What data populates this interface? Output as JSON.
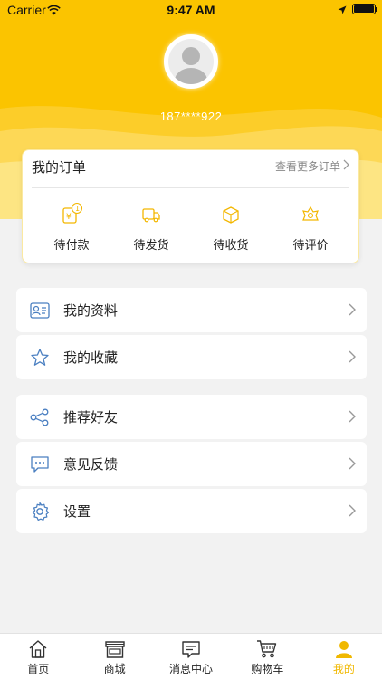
{
  "status_bar": {
    "carrier": "Carrier",
    "time": "9:47 AM"
  },
  "profile": {
    "phone": "187****922"
  },
  "orders": {
    "title": "我的订单",
    "more_label": "查看更多订单",
    "badge_count": "1",
    "items": [
      {
        "label": "待付款",
        "icon": "payment-icon"
      },
      {
        "label": "待发货",
        "icon": "truck-icon"
      },
      {
        "label": "待收货",
        "icon": "package-icon"
      },
      {
        "label": "待评价",
        "icon": "review-icon"
      }
    ]
  },
  "menu": {
    "group1": [
      {
        "label": "我的资料",
        "icon": "profile-card-icon"
      },
      {
        "label": "我的收藏",
        "icon": "star-icon"
      }
    ],
    "group2": [
      {
        "label": "推荐好友",
        "icon": "share-icon"
      },
      {
        "label": "意见反馈",
        "icon": "feedback-icon"
      },
      {
        "label": "设置",
        "icon": "gear-icon"
      }
    ]
  },
  "tabbar": {
    "items": [
      {
        "label": "首页",
        "icon": "home-icon"
      },
      {
        "label": "商城",
        "icon": "store-icon"
      },
      {
        "label": "消息中心",
        "icon": "message-icon"
      },
      {
        "label": "购物车",
        "icon": "cart-icon"
      },
      {
        "label": "我的",
        "icon": "user-icon"
      }
    ],
    "active_index": 4
  },
  "colors": {
    "brand": "#fbc400",
    "active_tab": "#f0b800",
    "icon_line": "#f3b700",
    "menu_icon": "#4a7fc1"
  }
}
